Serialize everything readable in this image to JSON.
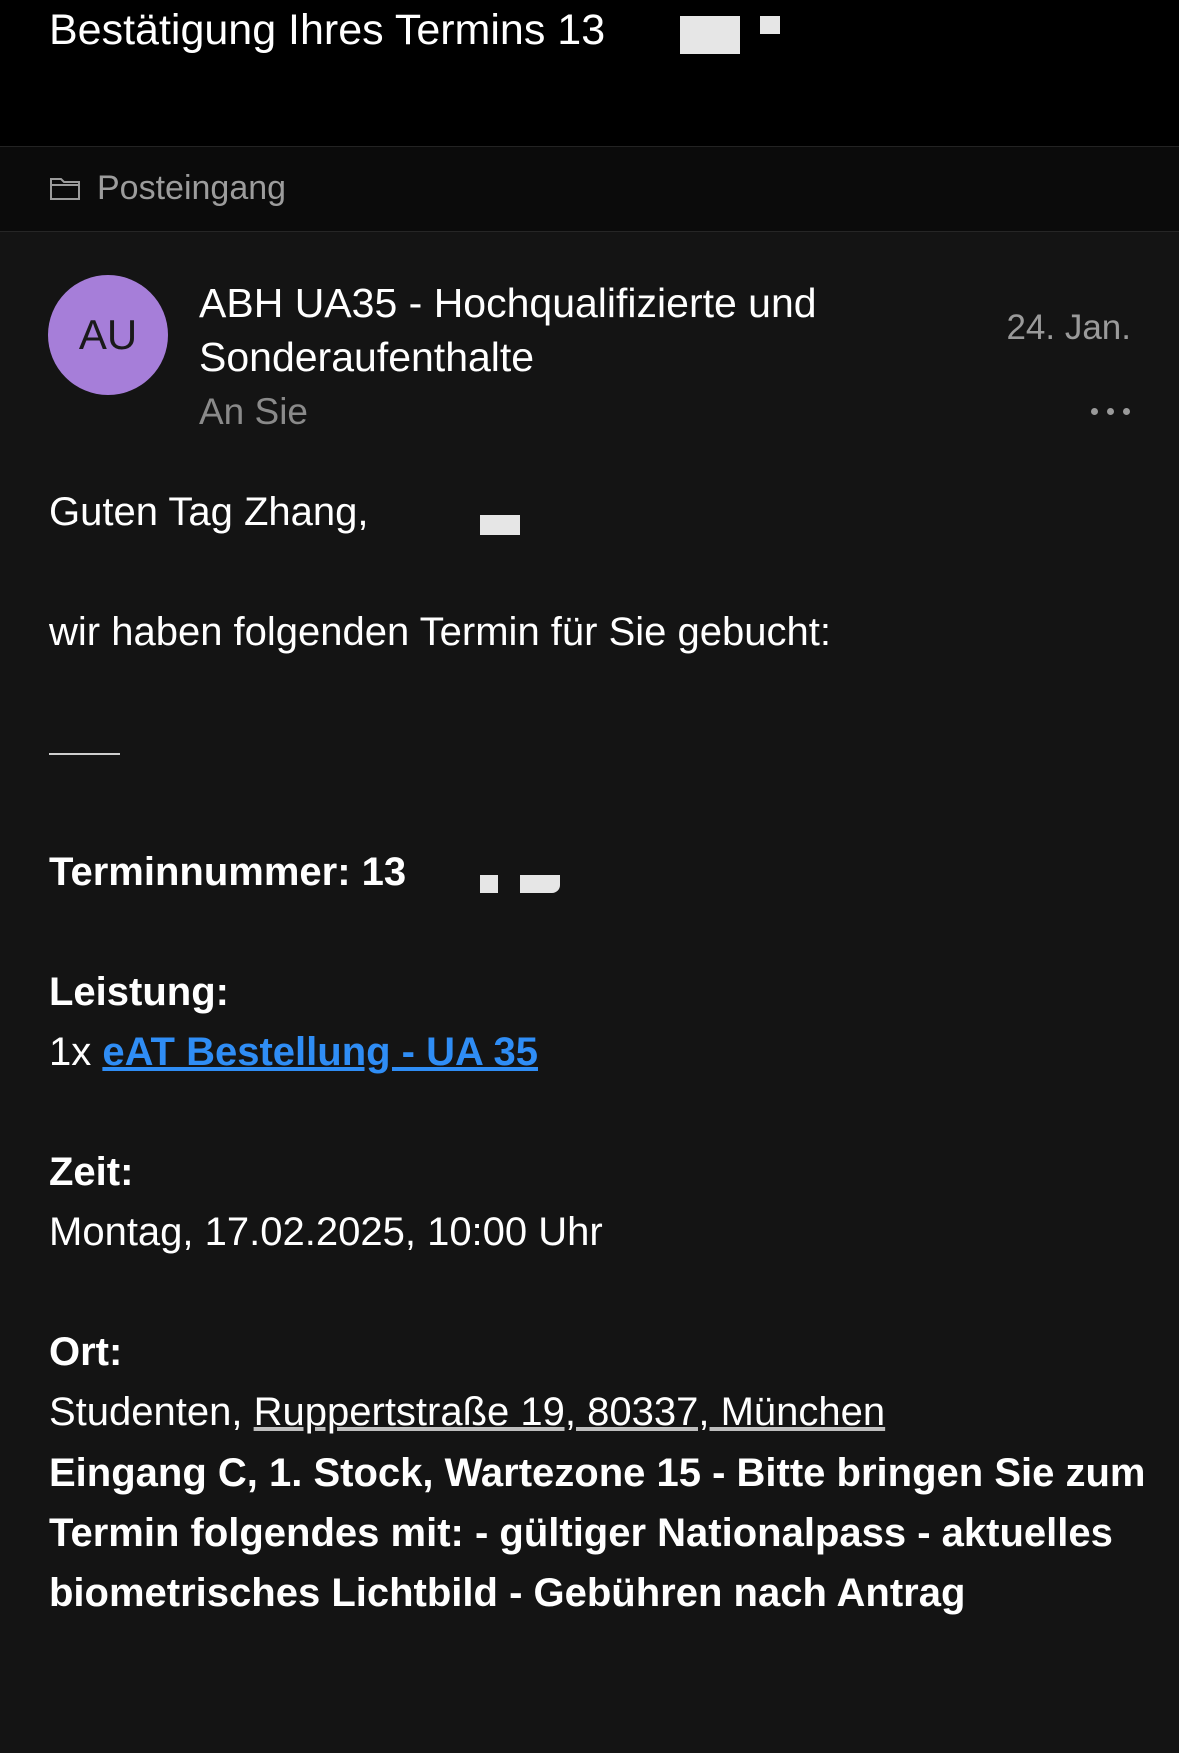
{
  "header": {
    "subject": "Bestätigung Ihres Termins 13"
  },
  "folder": {
    "icon": "folder-icon",
    "label": "Posteingang"
  },
  "message": {
    "avatar_initials": "AU",
    "avatar_color": "#a67ed9",
    "sender": "ABH UA35 - Hochqualifizierte und Sonderaufenthalte",
    "recipient": "An Sie",
    "date": "24. Jan.",
    "more_icon": "more-horizontal-icon"
  },
  "body": {
    "greeting": "Guten Tag Zhang,",
    "intro": "wir haben folgenden Termin für Sie gebucht:",
    "appointment_number_label": "Terminnummer:",
    "appointment_number_value": "13",
    "service_label": "Leistung:",
    "service_quantity": "1x",
    "service_link": "eAT Bestellung - UA 35",
    "time_label": "Zeit:",
    "time_value": "Montag, 17.02.2025, 10:00 Uhr",
    "place_label": "Ort:",
    "place_prefix": "Studenten,",
    "place_address": "Ruppertstraße 19, 80337, München",
    "note": "Eingang C, 1. Stock, Wartezone 15 - Bitte bringen Sie zum Termin folgendes mit: - gültiger Nationalpass - aktuelles biometrisches Lichtbild - Gebühren nach Antrag"
  },
  "colors": {
    "background": "#141414",
    "header_background": "#000000",
    "link": "#2f8df5",
    "muted_text": "#8a8a8a"
  }
}
